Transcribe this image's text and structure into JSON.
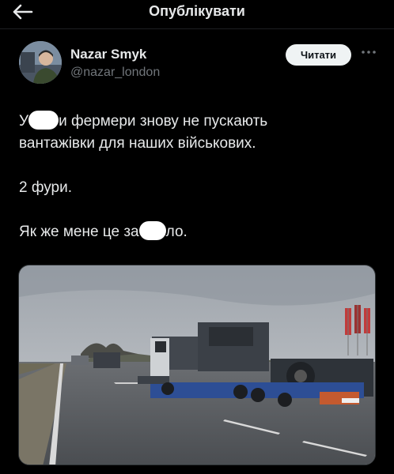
{
  "header": {
    "title": "Опублікувати",
    "back_icon": "arrow-left-icon"
  },
  "author": {
    "name": "Nazar Smyk",
    "handle": "@nazar_london",
    "follow_label": "Читати",
    "more_icon": "more-dots-icon"
  },
  "tweet": {
    "line1_start": "У",
    "line1_end": "и фермери знову не пускають",
    "line2": "вантажівки для наших військових.",
    "para2": "2 фури.",
    "para3_start": "Як же мене це за",
    "para3_end": "ло."
  },
  "media": {
    "kind": "photo",
    "description_icon": "photo-icon"
  },
  "colors": {
    "background": "#000000",
    "text": "#e7e9ea",
    "muted": "#71767b",
    "follow_bg": "#eff3f4"
  }
}
